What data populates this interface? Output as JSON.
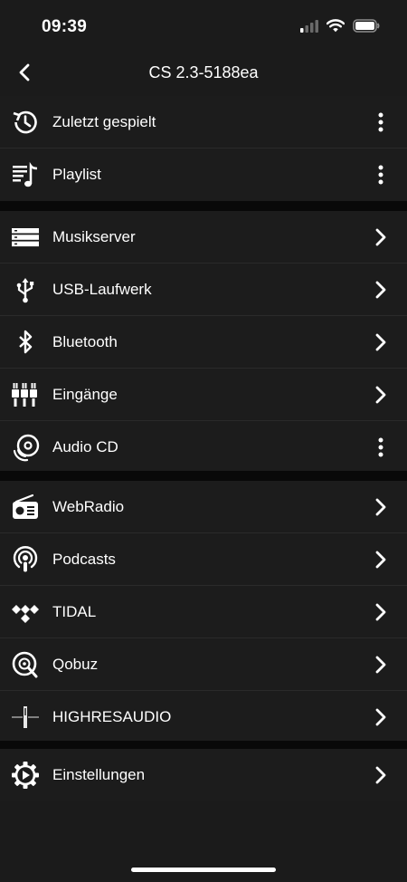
{
  "status_bar": {
    "time": "09:39"
  },
  "nav": {
    "title": "CS 2.3-5188ea"
  },
  "sections": [
    {
      "items": [
        {
          "label": "Zuletzt gespielt",
          "icon": "history-icon",
          "action": "more"
        },
        {
          "label": "Playlist",
          "icon": "playlist-icon",
          "action": "more"
        }
      ]
    },
    {
      "items": [
        {
          "label": "Musikserver",
          "icon": "server-icon",
          "action": "chevron"
        },
        {
          "label": "USB-Laufwerk",
          "icon": "usb-icon",
          "action": "chevron"
        },
        {
          "label": "Bluetooth",
          "icon": "bluetooth-icon",
          "action": "chevron"
        },
        {
          "label": "Eingänge",
          "icon": "inputs-icon",
          "action": "chevron"
        },
        {
          "label": "Audio CD",
          "icon": "cd-icon",
          "action": "more"
        }
      ]
    },
    {
      "items": [
        {
          "label": "WebRadio",
          "icon": "radio-icon",
          "action": "chevron"
        },
        {
          "label": "Podcasts",
          "icon": "podcast-icon",
          "action": "chevron"
        },
        {
          "label": "TIDAL",
          "icon": "tidal-icon",
          "action": "chevron"
        },
        {
          "label": "Qobuz",
          "icon": "qobuz-icon",
          "action": "chevron"
        },
        {
          "label": "HIGHRESAUDIO",
          "icon": "highresaudio-icon",
          "action": "chevron"
        }
      ]
    },
    {
      "items": [
        {
          "label": "Einstellungen",
          "icon": "settings-gear-icon",
          "action": "chevron"
        }
      ]
    }
  ]
}
